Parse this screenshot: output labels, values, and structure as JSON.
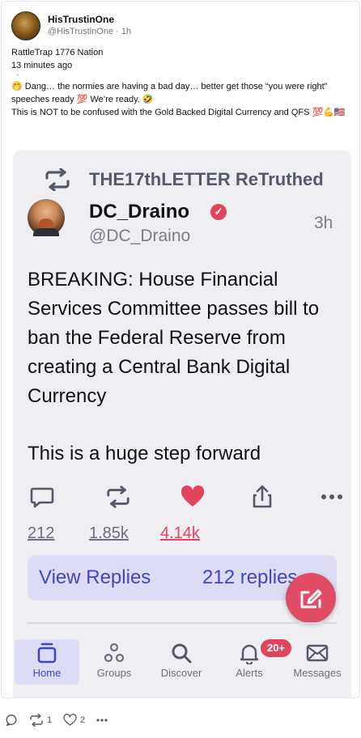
{
  "post": {
    "display_name": "HisTrustinOne",
    "handle": "@HisTrustinOne",
    "time": "1h",
    "lines": [
      "RattleTrap 1776 Nation",
      "13 minutes ago"
    ],
    "dot": "·",
    "body_line1": "🤭 Dang… the normies are having a bad day… better get those “you were right” speeches ready 💯 We’re ready. 🤣",
    "body_line2": "This is NOT to be confused with the Gold Backed Digital Currency and QFS 💯💪🇺🇸"
  },
  "embed": {
    "retruth_label": "THE17thLETTER ReTruthed",
    "author_name": "DC_Draino",
    "author_handle": "@DC_Draino",
    "author_time": "3h",
    "verified_glyph": "✓",
    "text_para1": "BREAKING: House Financial Services Committee passes bill to ban the Federal Reserve from creating a Central Bank Digital Currency",
    "text_para2": "This is a huge step forward",
    "counts": {
      "replies": "212",
      "retruths": "1.85k",
      "likes": "4.14k"
    },
    "view_replies_label": "View Replies",
    "view_replies_count": "212 replies",
    "tabs": [
      {
        "label": "Home",
        "icon": "home-icon",
        "active": true
      },
      {
        "label": "Groups",
        "icon": "groups-icon",
        "active": false
      },
      {
        "label": "Discover",
        "icon": "search-icon",
        "active": false
      },
      {
        "label": "Alerts",
        "icon": "bell-icon",
        "active": false
      },
      {
        "label": "Messages",
        "icon": "envelope-icon",
        "active": false
      }
    ],
    "alerts_badge": "20+"
  },
  "footer": {
    "retruths": "1",
    "likes": "2"
  },
  "colors": {
    "accent": "#4145c8",
    "like": "#e0455c",
    "muted": "#6b6f7d"
  }
}
